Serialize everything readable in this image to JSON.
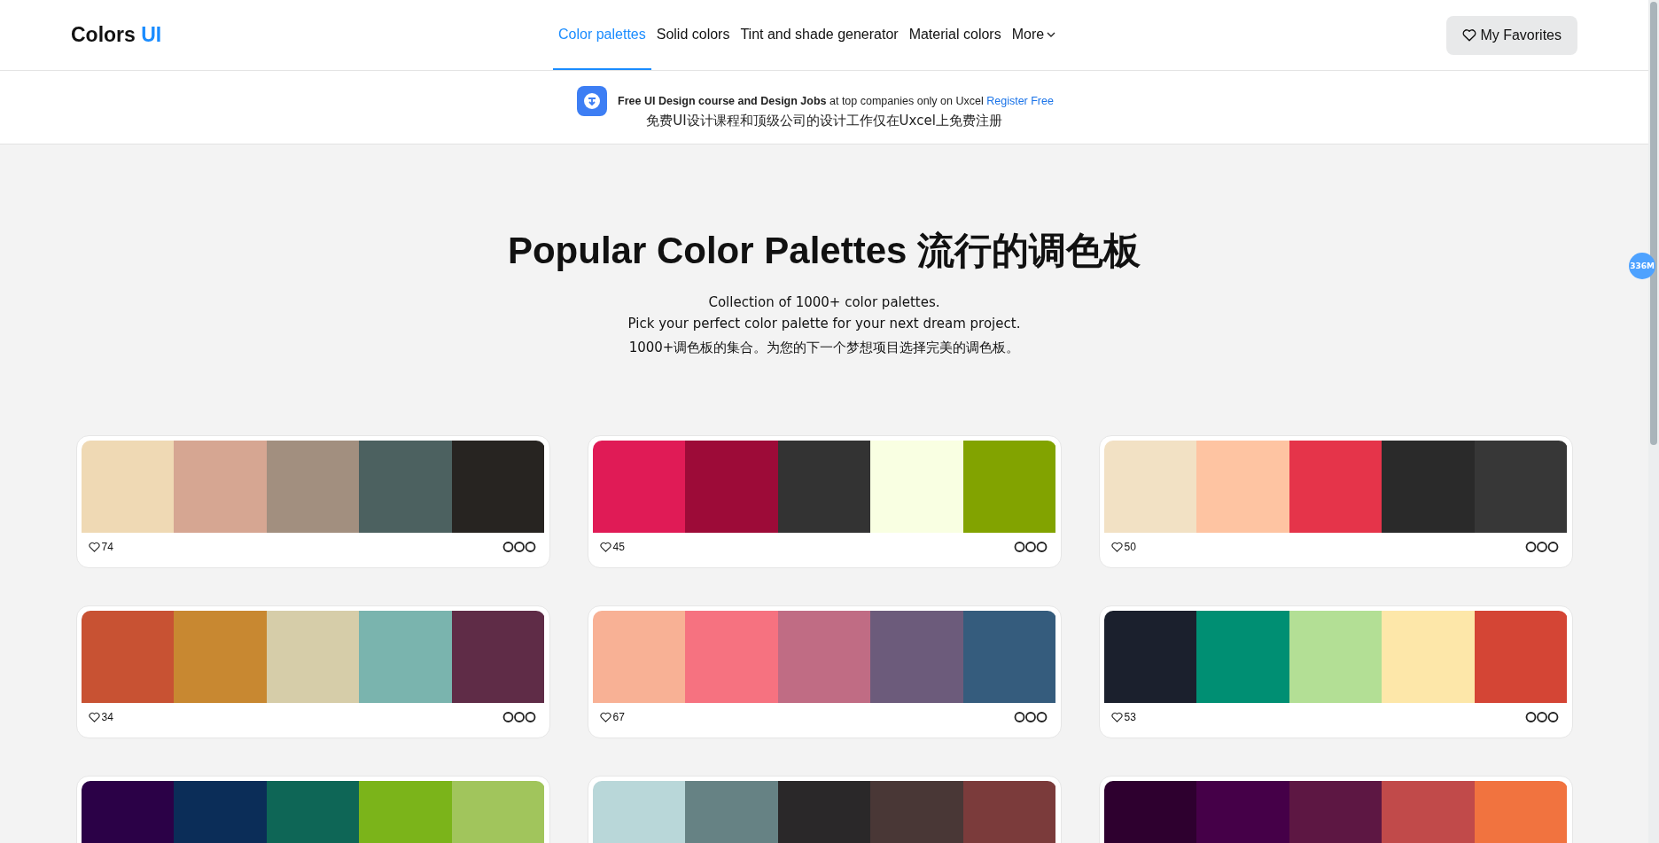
{
  "header": {
    "logo": {
      "text": "Colors",
      "accent": "UI"
    },
    "nav": [
      {
        "label": "Color palettes",
        "selected": true
      },
      {
        "label": "Solid colors",
        "selected": false
      },
      {
        "label": "Tint and shade generator",
        "selected": false
      },
      {
        "label": "Material colors",
        "selected": false
      },
      {
        "label": "More",
        "selected": false,
        "kind": "dropdown"
      }
    ],
    "favorites_button": "My Favorites"
  },
  "banner": {
    "text": "**Free UI Design course and Design Jobs** at top companies only on Uxcel",
    "link": "Register Free",
    "translation": "免费UI设计课程和顶级公司的设计工作仅在Uxcel上免费注册"
  },
  "hero": {
    "title": "Popular Color Palettes 流行的调色板",
    "subtitle": [
      "Collection of 1000+ color palettes.",
      "Pick your perfect color palette for your next dream project."
    ],
    "translation": "1000+调色板的集合。为您的下一个梦想项目选择完美的调色板。"
  },
  "palettes": [
    {
      "swatches": [
        {
          "color": "#efd9b4"
        },
        {
          "color": "#d6a692"
        },
        {
          "color": "#a28f7f"
        },
        {
          "color": "#4c6160"
        },
        {
          "color": "#272421"
        }
      ],
      "likes": "74"
    },
    {
      "swatches": [
        {
          "color": "#e01b56"
        },
        {
          "color": "#9d0b38"
        },
        {
          "color": "#333333"
        },
        {
          "color": "#f9ffe2"
        },
        {
          "color": "#82a300"
        }
      ],
      "likes": "45"
    },
    {
      "swatches": [
        {
          "color": "#f2e1c4"
        },
        {
          "color": "#fec4a2"
        },
        {
          "color": "#e5344a"
        },
        {
          "color": "#2a2a2a"
        },
        {
          "color": "#373737"
        }
      ],
      "likes": "50"
    },
    {
      "swatches": [
        {
          "color": "#c85233"
        },
        {
          "color": "#c88831"
        },
        {
          "color": "#d6cda9"
        },
        {
          "color": "#7ab4ae"
        },
        {
          "color": "#5f2c47"
        }
      ],
      "likes": "34"
    },
    {
      "swatches": [
        {
          "color": "#f8b195"
        },
        {
          "color": "#f67280"
        },
        {
          "color": "#c06c84"
        },
        {
          "color": "#6c5b7b"
        },
        {
          "color": "#355c7d"
        }
      ],
      "likes": "67"
    },
    {
      "swatches": [
        {
          "color": "#1b202d"
        },
        {
          "color": "#008f73"
        },
        {
          "color": "#b3df95"
        },
        {
          "color": "#fde7a9"
        },
        {
          "color": "#d44535"
        }
      ],
      "likes": "53"
    },
    {
      "swatches": [
        {
          "color": "#2b0147"
        },
        {
          "color": "#0b2d58"
        },
        {
          "color": "#0e6656"
        },
        {
          "color": "#7bb41a"
        },
        {
          "color": "#a1c55c"
        }
      ]
    },
    {
      "swatches": [
        {
          "color": "#b9d7d9"
        },
        {
          "color": "#668284"
        },
        {
          "color": "#2a2829"
        },
        {
          "color": "#493736"
        },
        {
          "color": "#7b3b3b"
        }
      ]
    },
    {
      "swatches": [
        {
          "color": "#2e002f"
        },
        {
          "color": "#450048"
        },
        {
          "color": "#5d1743"
        },
        {
          "color": "#c14a4a"
        },
        {
          "color": "#f1733f"
        }
      ]
    }
  ],
  "memory_badge": "336M"
}
